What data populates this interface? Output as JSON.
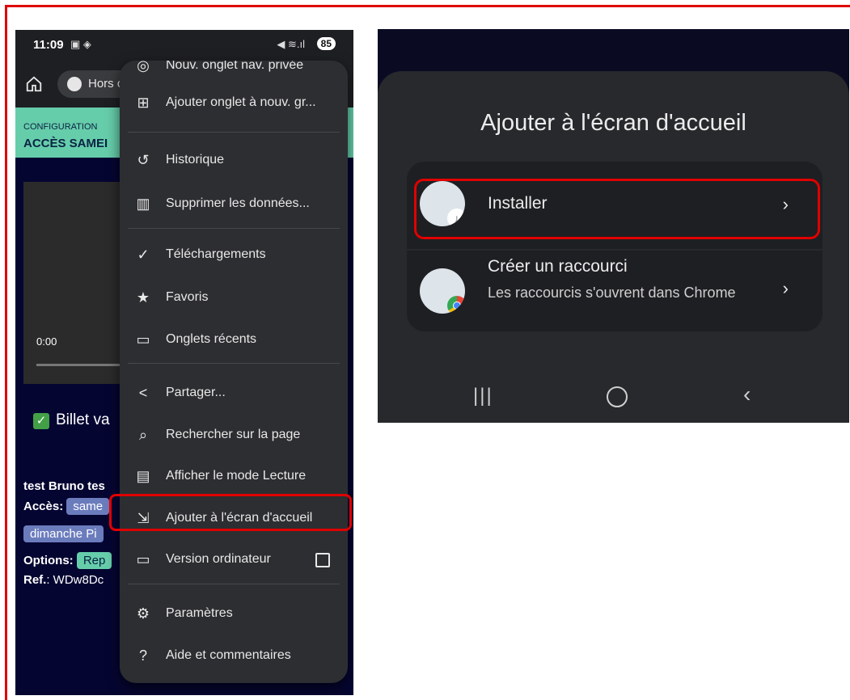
{
  "left_phone": {
    "status": {
      "time": "11:09",
      "left_icons": "▣ ◈",
      "right_icons": "◀ ≋.ıl",
      "battery": "85"
    },
    "urlbar": {
      "text": "Hors c"
    },
    "config": {
      "label": "CONFIGURATION",
      "title": "ACCÈS SAMEI"
    },
    "video": {
      "time": "0:00"
    },
    "billet": "Billet va",
    "info": {
      "name": "test Bruno tes",
      "acces_label": "Accès:",
      "acces_tag1": "same",
      "acces_tag2": "dimanche Pi",
      "options_label": "Options:",
      "options_tag": "Rep",
      "ref_label": "Ref.",
      "ref_value": ": WDw8Dc"
    },
    "menu": {
      "items": [
        {
          "label": "Nouv. onglet nav. privée",
          "icon": "incognito-icon"
        },
        {
          "label": "Ajouter onglet à nouv. gr...",
          "icon": "add-to-group-icon"
        },
        {
          "label": "Historique",
          "icon": "history-icon"
        },
        {
          "label": "Supprimer les données...",
          "icon": "trash-icon"
        },
        {
          "label": "Téléchargements",
          "icon": "download-check-icon"
        },
        {
          "label": "Favoris",
          "icon": "star-icon"
        },
        {
          "label": "Onglets récents",
          "icon": "devices-icon"
        },
        {
          "label": "Partager...",
          "icon": "share-icon"
        },
        {
          "label": "Rechercher sur la page",
          "icon": "find-in-page-icon"
        },
        {
          "label": "Afficher le mode Lecture",
          "icon": "reader-mode-icon"
        },
        {
          "label": "Ajouter à l'écran d'accueil",
          "icon": "add-to-home-icon"
        },
        {
          "label": "Version ordinateur",
          "icon": "desktop-icon"
        },
        {
          "label": "Paramètres",
          "icon": "gear-icon"
        },
        {
          "label": "Aide et commentaires",
          "icon": "help-icon"
        }
      ]
    }
  },
  "right_phone": {
    "title": "Ajouter à l'écran d'accueil",
    "install": {
      "label": "Installer"
    },
    "shortcut": {
      "label": "Créer un raccourci",
      "sub": "Les raccourcis s'ouvrent dans Chrome"
    }
  },
  "colors": {
    "highlight": "#e00000",
    "teal": "#66cdaa",
    "navy": "#050532"
  }
}
